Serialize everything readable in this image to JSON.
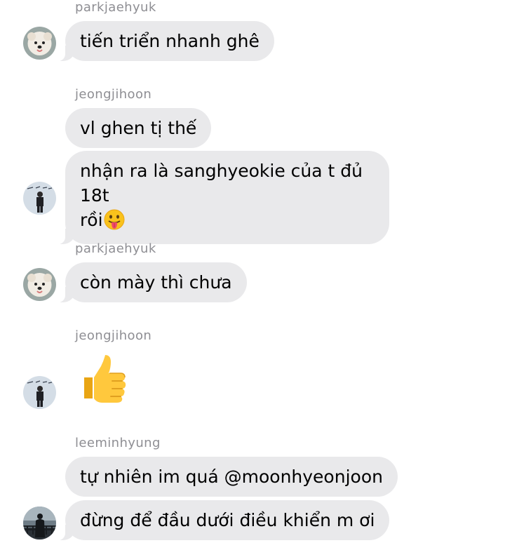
{
  "messages": [
    {
      "sender": "parkjaehyuk",
      "text": "tiến triển nhanh ghê"
    },
    {
      "sender": "jeongjihoon",
      "text": "vl ghen tị thế"
    },
    {
      "sender": "jeongjihoon",
      "text_line1": "nhận ra là sanghyeokie của t đủ 18t",
      "text_line2": "rồi",
      "emoji": "face-with-tongue-icon"
    },
    {
      "sender": "parkjaehyuk",
      "text": "còn mày thì chưa"
    },
    {
      "sender": "jeongjihoon",
      "emoji": "thumbs-up-icon"
    },
    {
      "sender": "leeminhyung",
      "text": "tự nhiên im quá @moonhyeonjoon"
    },
    {
      "sender": "leeminhyung",
      "text": "đừng để đầu dưới điều khiển m ơi"
    }
  ],
  "colors": {
    "bubble": "#e9e9eb",
    "sender_name": "#8e8e93",
    "text": "#000000"
  },
  "avatars": {
    "parkjaehyuk": "white-dog-avatar",
    "jeongjihoon": "person-photo-avatar",
    "leeminhyung": "silhouette-railing-avatar"
  }
}
